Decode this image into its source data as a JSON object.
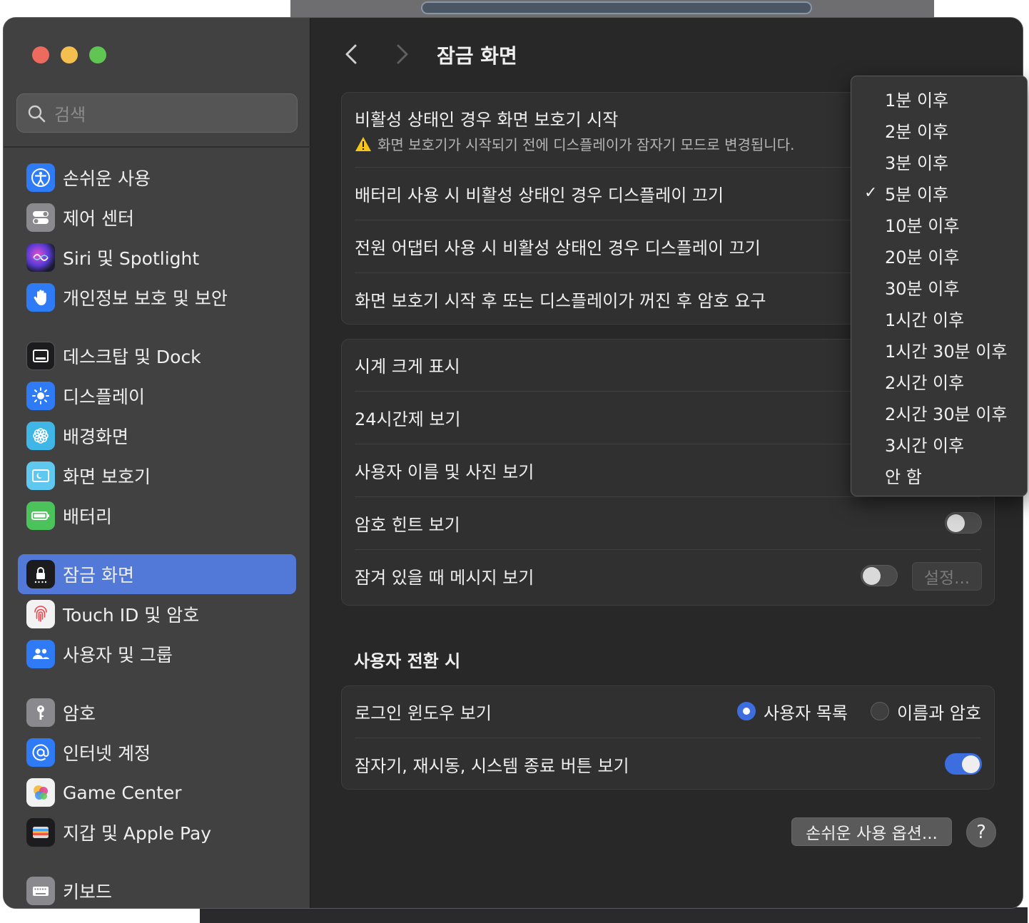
{
  "colors": {
    "accent": "#5379d8",
    "toggle_on": "#3c6ee0",
    "traffic_red": "#ed6a5e",
    "traffic_yellow": "#f5bf4f",
    "traffic_green": "#61c554",
    "warning": "#f5c518"
  },
  "sidebar": {
    "search_placeholder": "검색",
    "items": [
      {
        "label": "손쉬운 사용",
        "icon": "accessibility-icon"
      },
      {
        "label": "제어 센터",
        "icon": "control-center-icon"
      },
      {
        "label": "Siri 및 Spotlight",
        "icon": "siri-icon"
      },
      {
        "label": "개인정보 보호 및 보안",
        "icon": "hand-icon"
      },
      {
        "label": "데스크탑 및 Dock",
        "icon": "dock-icon"
      },
      {
        "label": "디스플레이",
        "icon": "brightness-icon"
      },
      {
        "label": "배경화면",
        "icon": "flower-icon"
      },
      {
        "label": "화면 보호기",
        "icon": "screensaver-icon"
      },
      {
        "label": "배터리",
        "icon": "battery-icon"
      },
      {
        "label": "잠금 화면",
        "icon": "lock-icon",
        "selected": true
      },
      {
        "label": "Touch ID 및 암호",
        "icon": "fingerprint-icon"
      },
      {
        "label": "사용자 및 그룹",
        "icon": "users-icon"
      },
      {
        "label": "암호",
        "icon": "key-icon"
      },
      {
        "label": "인터넷 계정",
        "icon": "at-icon"
      },
      {
        "label": "Game Center",
        "icon": "game-center-icon"
      },
      {
        "label": "지갑 및 Apple Pay",
        "icon": "wallet-icon"
      },
      {
        "label": "키보드",
        "icon": "keyboard-icon"
      }
    ]
  },
  "main": {
    "title": "잠금 화면",
    "group1": {
      "screensaver_label": "비활성 상태인 경우 화면 보호기 시작",
      "screensaver_warning": "화면 보호기가 시작되기 전에 디스플레이가 잠자기 모드로 변경됩니다.",
      "battery_label": "배터리 사용 시 비활성 상태인 경우 디스플레이 끄기",
      "adapter_label": "전원 어댑터 사용 시 비활성 상태인 경우 디스플레이 끄기",
      "password_label": "화면 보호기 시작 후 또는 디스플레이가 꺼진 후 암호 요구"
    },
    "group2": {
      "large_clock_label": "시계 크게 표시",
      "clock24_label": "24시간제 보기",
      "username_photo_label": "사용자 이름 및 사진 보기",
      "password_hint_label": "암호 힌트 보기",
      "password_hint_on": false,
      "locked_message_label": "잠겨 있을 때 메시지 보기",
      "locked_message_on": false,
      "set_button": "설정..."
    },
    "section_title": "사용자 전환 시",
    "group3": {
      "login_window_label": "로그인 윈도우 보기",
      "option_user_list": "사용자 목록",
      "option_name_password": "이름과 암호",
      "selected_option": "사용자 목록",
      "power_buttons_label": "잠자기, 재시동, 시스템 종료 버튼 보기",
      "power_buttons_on": true
    },
    "accessibility_options_button": "손쉬운 사용 옵션...",
    "help_button": "?"
  },
  "popup_menu": {
    "checkmark": "✓",
    "selected": "5분 이후",
    "options": [
      "1분 이후",
      "2분 이후",
      "3분 이후",
      "5분 이후",
      "10분 이후",
      "20분 이후",
      "30분 이후",
      "1시간 이후",
      "1시간 30분 이후",
      "2시간 이후",
      "2시간 30분 이후",
      "3시간 이후",
      "안 함"
    ]
  }
}
